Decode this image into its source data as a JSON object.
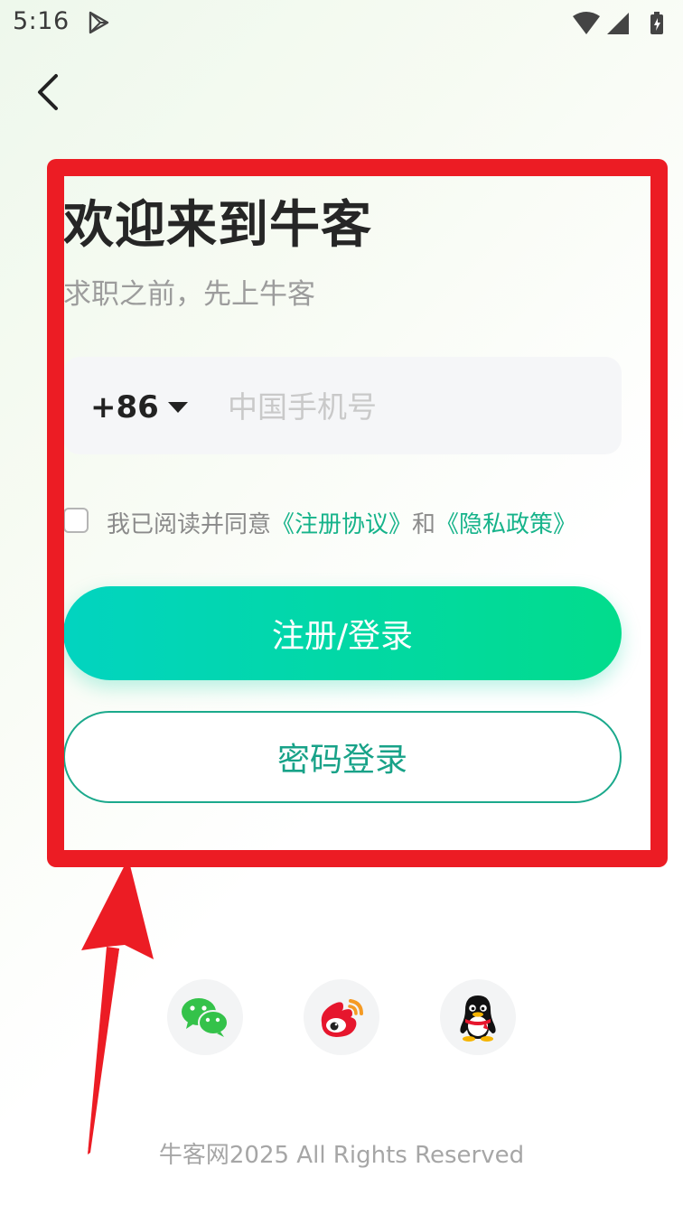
{
  "status_bar": {
    "time": "5:16"
  },
  "header": {
    "back_icon": "chevron-left-icon"
  },
  "login": {
    "title": "欢迎来到牛客",
    "subtitle": "求职之前，先上牛客",
    "country_code": "+86",
    "phone_placeholder": "中国手机号",
    "phone_value": "",
    "agree_prefix": "我已阅读并同意",
    "terms_link": "《注册协议》",
    "agree_and": "和",
    "privacy_link": "《隐私政策》",
    "primary_button": "注册/登录",
    "secondary_button": "密码登录"
  },
  "social_login": [
    {
      "name": "wechat",
      "icon": "wechat-icon"
    },
    {
      "name": "weibo",
      "icon": "weibo-icon"
    },
    {
      "name": "qq",
      "icon": "qq-icon"
    }
  ],
  "footer": {
    "copyright": "牛客网2025 All Rights Reserved"
  },
  "colors": {
    "accent": "#16b38a",
    "button_gradient_start": "#02d4c0",
    "button_gradient_end": "#02dc8c",
    "annotation_red": "#ec1c24"
  }
}
